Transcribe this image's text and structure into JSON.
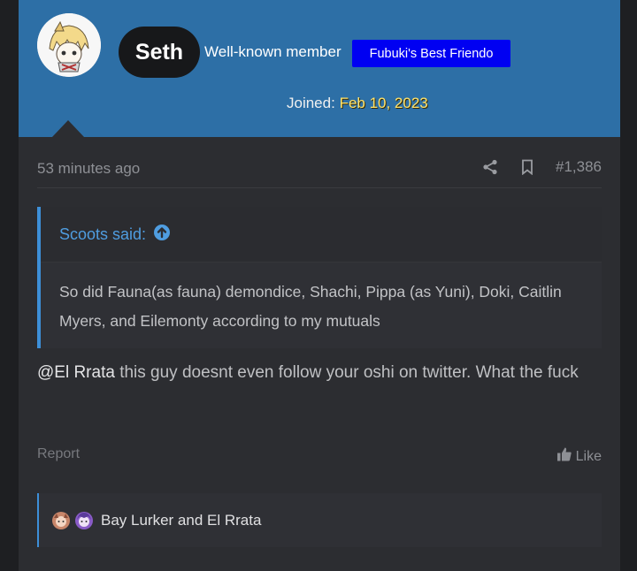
{
  "user": {
    "name": "Seth",
    "title": "Well-known member",
    "banner": "Fubuki's Best Friendo",
    "banner_color": "#0000f2",
    "joined_label": "Joined:",
    "joined_date": "Feb 10, 2023"
  },
  "meta": {
    "time": "53 minutes ago",
    "post_number": "#1,386",
    "share_icon": "share-icon",
    "bookmark_icon": "bookmark-icon"
  },
  "quote": {
    "author_said": "Scoots said:",
    "text": "So did Fauna(as fauna) demondice, Shachi, Pippa (as Yuni), Doki, Caitlin Myers, and Eilemonty according to my mutuals"
  },
  "message": {
    "mention": "@El Rrata",
    "text": " this guy doesnt even follow your oshi on twitter. What the fuck"
  },
  "actions": {
    "report": "Report",
    "like": "Like"
  },
  "reactions": {
    "text": "Bay Lurker and El Rrata"
  },
  "colors": {
    "header_bg": "#2d6fa6",
    "post_bg": "#2c2d31",
    "accent": "#3d8fd8"
  }
}
